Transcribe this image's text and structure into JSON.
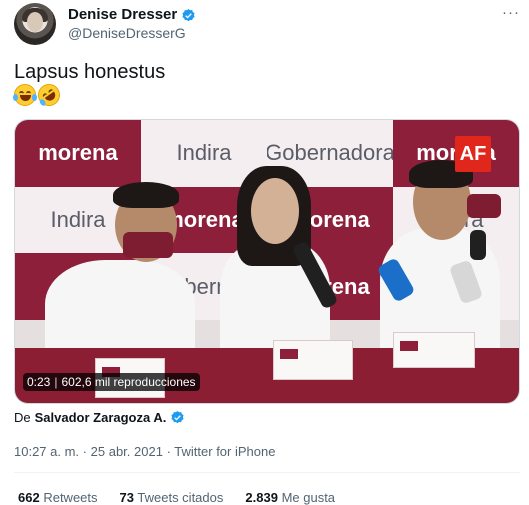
{
  "author": {
    "name": "Denise Dresser",
    "handle": "@DeniseDresserG",
    "verified": true,
    "avatar_icon": "profile-photo"
  },
  "more_label": "···",
  "tweet": {
    "text": "Lapsus honestus",
    "emojis": [
      "face-with-tears-of-joy",
      "rolling-on-the-floor-laughing"
    ]
  },
  "video": {
    "duration": "0:23",
    "views": "602,6 mil reproducciones",
    "watermark": "AF",
    "wall_text": [
      "morena",
      "Indira",
      "Gobernadora",
      "morena",
      "Indira",
      "Gobernad",
      "morena",
      "Indira",
      "Gobern",
      "m",
      "morena",
      "morena"
    ]
  },
  "source": {
    "prefix": "De",
    "name": "Salvador Zaragoza A.",
    "verified": true
  },
  "meta": {
    "time": "10:27 a. m.",
    "separator": "·",
    "date": "25 abr. 2021",
    "client": "Twitter for iPhone"
  },
  "stats": {
    "retweets_count": "662",
    "retweets_label": "Retweets",
    "quotes_count": "73",
    "quotes_label": "Tweets citados",
    "likes_count": "2.839",
    "likes_label": "Me gusta"
  },
  "colors": {
    "verified": "#1d9bf0",
    "morena_red": "#8d1f3a",
    "secondary_text": "#536471"
  }
}
